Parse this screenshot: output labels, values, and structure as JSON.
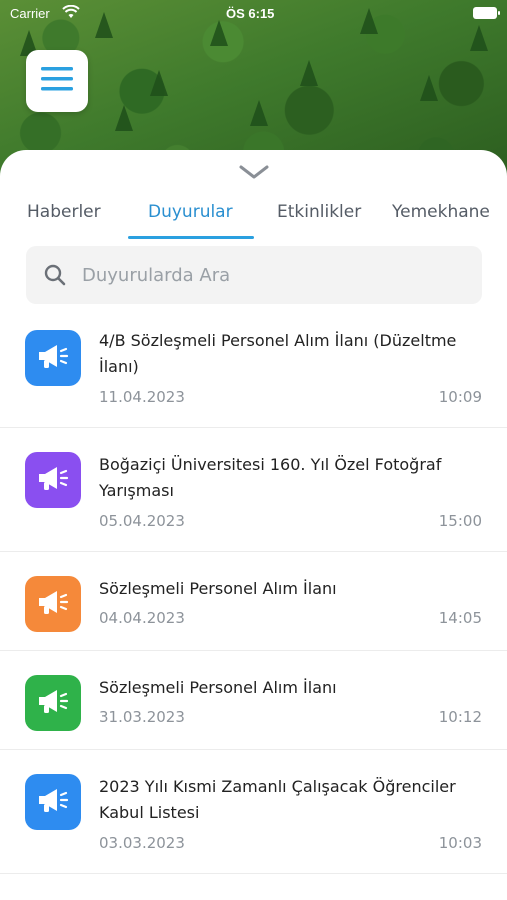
{
  "status_bar": {
    "carrier": "Carrier",
    "time": "ÖS 6:15"
  },
  "tabs": [
    {
      "label": "Haberler",
      "active": false
    },
    {
      "label": "Duyurular",
      "active": true
    },
    {
      "label": "Etkinlikler",
      "active": false
    },
    {
      "label": "Yemekhane",
      "active": false
    }
  ],
  "search": {
    "placeholder": "Duyurularda Ara",
    "value": ""
  },
  "announcements": [
    {
      "title": "4/B Sözleşmeli Personel Alım İlanı (Düzeltme İlanı)",
      "date": "11.04.2023",
      "time": "10:09",
      "color": "#2e8cf0",
      "icon": "megaphone-icon"
    },
    {
      "title": "Boğaziçi Üniversitesi 160. Yıl Özel Fotoğraf Yarışması",
      "date": "05.04.2023",
      "time": "15:00",
      "color": "#8a4ff0",
      "icon": "megaphone-icon"
    },
    {
      "title": "Sözleşmeli Personel Alım İlanı",
      "date": "04.04.2023",
      "time": "14:05",
      "color": "#f5893a",
      "icon": "megaphone-icon"
    },
    {
      "title": "Sözleşmeli Personel Alım İlanı",
      "date": "31.03.2023",
      "time": "10:12",
      "color": "#2fb24a",
      "icon": "megaphone-icon"
    },
    {
      "title": "2023 Yılı Kısmi Zamanlı Çalışacak Öğrenciler Kabul Listesi",
      "date": "03.03.2023",
      "time": "10:03",
      "color": "#2e8cf0",
      "icon": "megaphone-icon"
    }
  ],
  "colors": {
    "accent": "#2aa0e0",
    "menu_icon": "#2aa0e0"
  }
}
